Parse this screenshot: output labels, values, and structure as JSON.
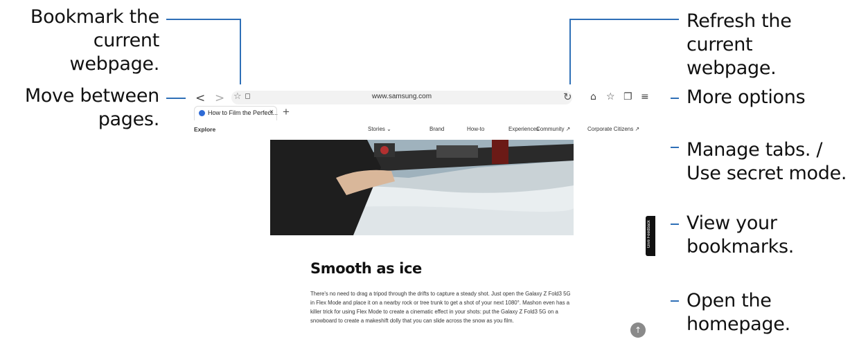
{
  "callouts": {
    "bookmark": [
      "Bookmark the",
      "current webpage."
    ],
    "move": [
      "Move between",
      "pages."
    ],
    "refresh": [
      "Refresh the current",
      "webpage."
    ],
    "more": "More options",
    "tabs": [
      "Manage tabs. /",
      "Use secret mode."
    ],
    "view_bookmarks": [
      "View your",
      "bookmarks."
    ],
    "home": [
      "Open the",
      "homepage."
    ]
  },
  "browser": {
    "url": "www.samsung.com",
    "tab_title": "How to Film the Perfect...",
    "tab_close": "×",
    "new_tab": "+",
    "back": "<",
    "forward": ">"
  },
  "site": {
    "explore": "Explore",
    "nav": [
      "Stories ⌄",
      "Brand",
      "How-to",
      "Experiences",
      "Community ↗",
      "Corporate Citizens ↗"
    ],
    "heading": "Smooth as ice",
    "paragraph": "There's no need to drag a tripod through the drifts to capture a steady shot. Just open the Galaxy Z Fold3 5G in Flex Mode and place it on a nearby rock or tree trunk to get a shot of your next 1080°. Mashon even has a killer trick for using Flex Mode to create a cinematic effect in your shots: put the Galaxy Z Fold3 5G on a snowboard to create a makeshift dolly that you can slide across the snow as you film.",
    "feedback": "Give Feedback"
  },
  "icons": [
    "star-icon",
    "lock-icon",
    "refresh-icon",
    "home-icon",
    "bookmarks-icon",
    "tabs-icon",
    "menu-icon",
    "arrow-up-icon"
  ],
  "colors": {
    "callout_line": "#2e6fb7"
  }
}
